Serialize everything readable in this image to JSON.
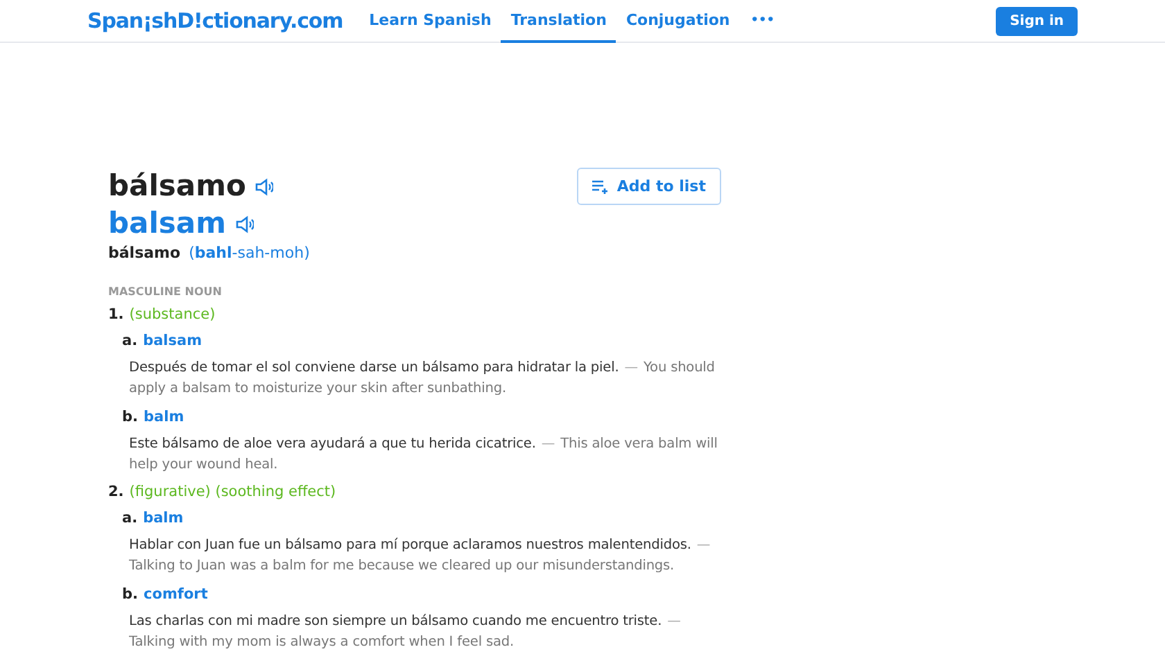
{
  "nav": {
    "logo": "Span¡shD!ctionary.com",
    "links": [
      {
        "label": "Learn Spanish",
        "selected": false
      },
      {
        "label": "Translation",
        "selected": true
      },
      {
        "label": "Conjugation",
        "selected": false
      }
    ],
    "more": "•••",
    "sign_in": "Sign in"
  },
  "entry": {
    "headword": "bálsamo",
    "translation": "balsam",
    "pron_word": "bálsamo",
    "pronunciation": "(**bahl**-sah-moh)",
    "add_button": "Add to list",
    "part_of_speech": "MASCULINE NOUN",
    "senses": [
      {
        "number": "1.",
        "context": "(substance)",
        "translations": [
          {
            "letter": "a.",
            "word": "balsam",
            "source": "Después de tomar el sol conviene darse un bálsamo para hidratar la piel.",
            "separator": "—",
            "target": "You should apply a balsam to moisturize your skin after sunbathing."
          },
          {
            "letter": "b.",
            "word": "balm",
            "source": "Este bálsamo de aloe vera ayudará a que tu herida cicatrice.",
            "separator": "—",
            "target": "This aloe vera balm will help your wound heal."
          }
        ]
      },
      {
        "number": "2.",
        "context": "(figurative) (soothing effect)",
        "translations": [
          {
            "letter": "a.",
            "word": "balm",
            "source": "Hablar con Juan fue un bálsamo para mí porque aclaramos nuestros malentendidos.",
            "separator": "—",
            "target": "Talking to Juan was a balm for me because we cleared up our misunderstandings."
          },
          {
            "letter": "b.",
            "word": "comfort",
            "source": "Las charlas con mi madre son siempre un bálsamo cuando me encuentro triste.",
            "separator": "—",
            "target": "Talking with my mom is always a comfort when I feel sad."
          }
        ]
      }
    ]
  }
}
